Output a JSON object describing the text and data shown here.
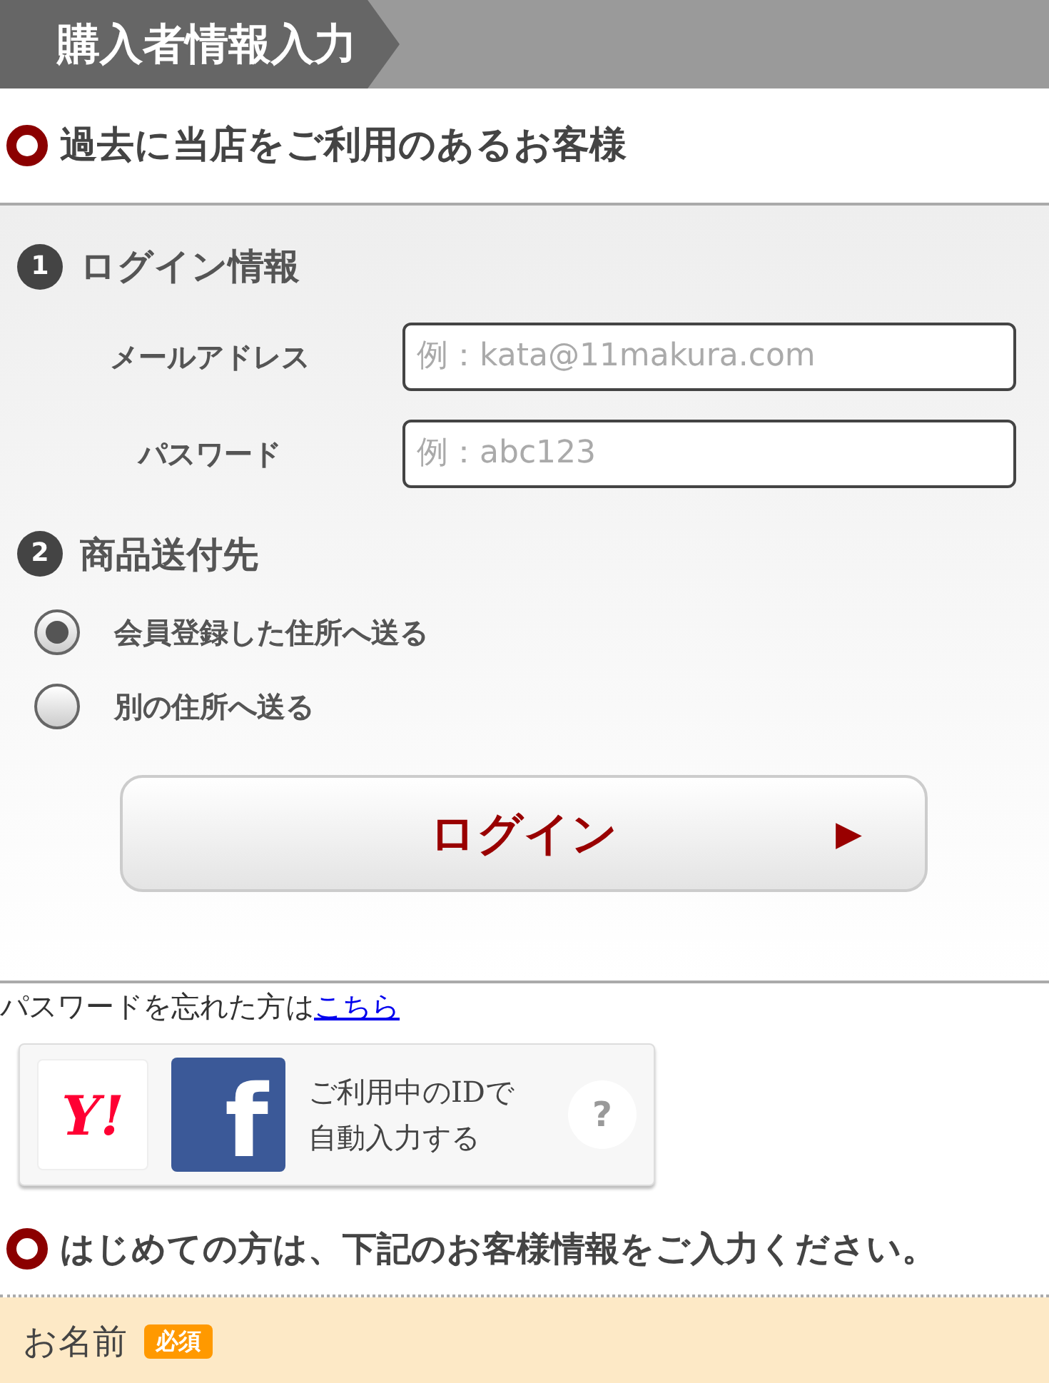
{
  "header": {
    "title": "購入者情報入力"
  },
  "returning": {
    "heading": "過去に当店をご利用のあるお客様",
    "login": {
      "number": "1",
      "title": "ログイン情報",
      "fields": [
        {
          "label": "メールアドレス",
          "placeholder": "例：kata@11makura.com"
        },
        {
          "label": "パスワード",
          "placeholder": "例：abc123"
        }
      ]
    },
    "shipping": {
      "number": "2",
      "title": "商品送付先",
      "options": [
        {
          "label": "会員登録した住所へ送る",
          "selected": true
        },
        {
          "label": "別の住所へ送る",
          "selected": false
        }
      ]
    },
    "login_button": {
      "label": "ログイン",
      "arrow": "▶"
    }
  },
  "forgot": {
    "text": "パスワードを忘れた方は",
    "link": "こちら"
  },
  "social": {
    "yahoo": "Y!",
    "facebook": "f",
    "text_lines": [
      "ご利用中のIDで",
      "自動入力する"
    ],
    "help": "?"
  },
  "new_customer": {
    "heading": "はじめての方は、下記のお客様情報をご入力ください。"
  },
  "name_field": {
    "label": "お名前",
    "badge": "必須"
  }
}
